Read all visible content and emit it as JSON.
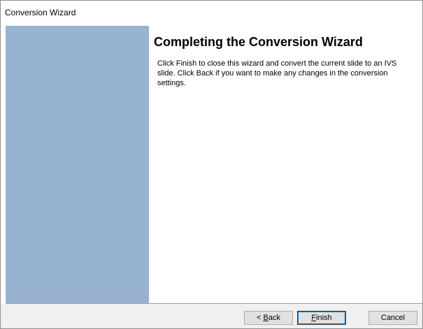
{
  "window": {
    "title": "Conversion Wizard"
  },
  "page": {
    "heading": "Completing the Conversion Wizard",
    "description": "Click Finish to close this wizard and convert the current slide to an IVS slide. Click Back if you want to make any changes in the conversion settings."
  },
  "buttons": {
    "back": {
      "prefix": "< ",
      "mnemonic": "B",
      "rest": "ack"
    },
    "finish": {
      "prefix": "",
      "mnemonic": "F",
      "rest": "inish"
    },
    "cancel": {
      "label": "Cancel"
    }
  },
  "colors": {
    "sidebar": "#98b2d2",
    "footer": "#f0f0f0",
    "default_button_focus": "#0078d7"
  }
}
